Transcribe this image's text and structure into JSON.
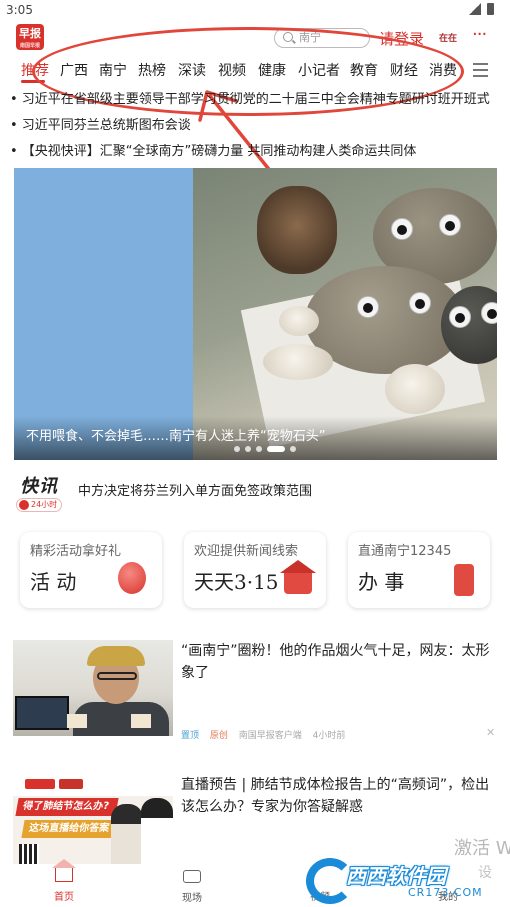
{
  "status_bar": {
    "time": "3:05"
  },
  "header": {
    "logo_text": "早报",
    "logo_sub": "南国早报",
    "search_placeholder": "南宁",
    "login_label": "请登录",
    "avatar_text": "在在",
    "more_label": "···"
  },
  "tabs": [
    "推荐",
    "广西",
    "南宁",
    "热榜",
    "深读",
    "视频",
    "健康",
    "小记者",
    "教育",
    "财经",
    "消费"
  ],
  "active_tab": "推荐",
  "headlines": [
    "• 习近平在省部级主要领导干部学习贯彻党的二十届三中全会精神专题研讨班开班式",
    "• 习近平同芬兰总统斯图布会谈",
    "• 【央视快评】汇聚“全球南方”磅礴力量 共同推动构建人类命运共同体"
  ],
  "carousel": {
    "caption": "不用喂食、不会掉毛……南宁有人迷上养“宠物石头”",
    "slide_count": 5,
    "active_slide": 4
  },
  "express": {
    "logo": "快讯",
    "badge": "24小时",
    "text": "中方决定将芬兰列入单方面免签政策范围"
  },
  "cards": [
    {
      "sub": "精彩活动拿好礼",
      "main": "活 动"
    },
    {
      "sub": "欢迎提供新闻线索",
      "main": "天天3·15"
    },
    {
      "sub": "直通南宁12345",
      "main": "办 事"
    }
  ],
  "news": [
    {
      "title": "“画南宁”圈粉！他的作品烟火气十足，网友：太形象了",
      "tag1": "置顶",
      "tag2": "原创",
      "source": "南国早报客户端",
      "time": "4小时前"
    },
    {
      "title": "直播预告 | 肺结节成体检报告上的“高频词”，检出该怎么办？专家为你答疑解惑",
      "thumb_line1": "得了肺结节怎么办?",
      "thumb_line2": "这场直播给你答案"
    }
  ],
  "watermark": {
    "line1": "激活 W",
    "line2": "设"
  },
  "site_logo": {
    "name": "西西软件园",
    "url": "CR173.COM"
  },
  "bottom_nav": [
    {
      "label": "首页",
      "icon": "home-icon",
      "active": true
    },
    {
      "label": "现场",
      "icon": "tv-icon",
      "active": false
    },
    {
      "label": "视频",
      "icon": "video-icon",
      "active": false
    },
    {
      "label": "我的",
      "icon": "user-icon",
      "active": false
    }
  ],
  "colors": {
    "accent": "#d9322c",
    "annotation": "#e0473a",
    "link_blue": "#4a9fd6"
  }
}
